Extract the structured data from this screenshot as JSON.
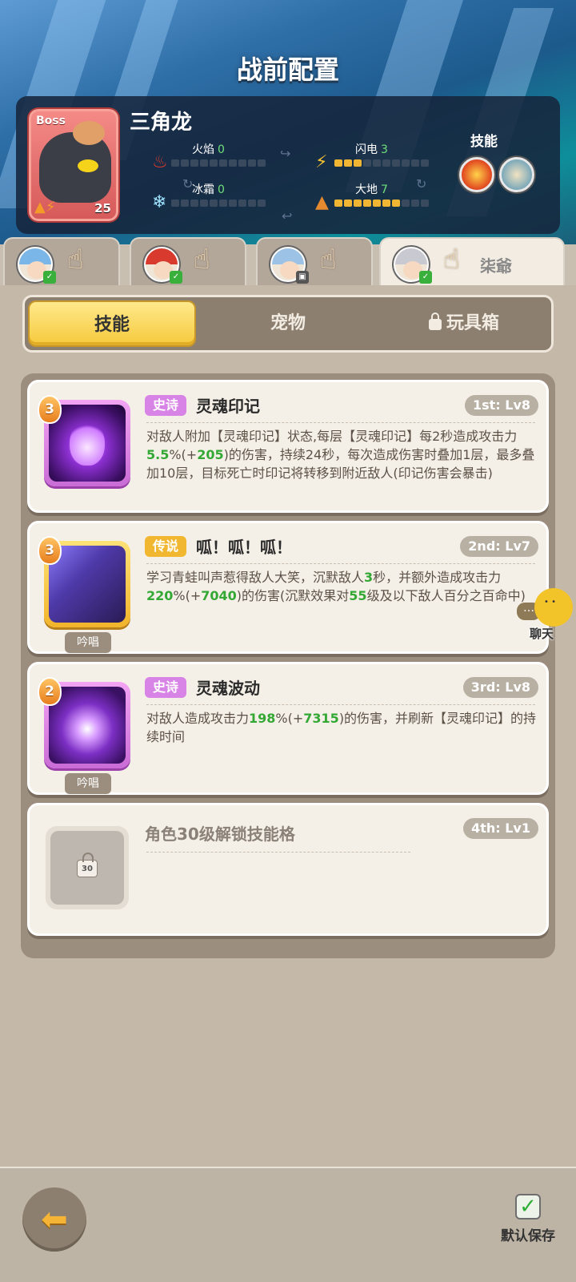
{
  "header": {
    "title": "战前配置"
  },
  "boss": {
    "tag": "Boss",
    "name": "三角龙",
    "level": "25",
    "stats": [
      {
        "label": "火焰",
        "value": "0",
        "icon": "fire-icon",
        "filled": 0,
        "total": 10
      },
      {
        "label": "闪电",
        "value": "3",
        "icon": "lightning-icon",
        "filled": 3,
        "total": 10
      },
      {
        "label": "冰霜",
        "value": "0",
        "icon": "snowflake-icon",
        "filled": 0,
        "total": 10
      },
      {
        "label": "大地",
        "value": "7",
        "icon": "earth-icon",
        "filled": 7,
        "total": 10
      }
    ],
    "skills_label": "技能"
  },
  "characters": [
    {
      "name": "",
      "hair": "#7bb6e8",
      "badge": "green"
    },
    {
      "name": "",
      "hair": "#d93a2e",
      "badge": "green"
    },
    {
      "name": "",
      "hair": "#9cc3e6",
      "badge": "gray"
    },
    {
      "name": "柒爺",
      "hair": "#c9c9d2",
      "badge": "green",
      "active": true
    }
  ],
  "tabs": {
    "skills": "技能",
    "pets": "宠物",
    "toybox": "玩具箱"
  },
  "skill_cards": [
    {
      "level": "3",
      "rarity": "史诗",
      "name": "灵魂印记",
      "slot": "1st: Lv8",
      "desc_parts": [
        {
          "t": "对敌人附加【灵魂印记】状态,每层【灵魂印记】每2秒造成攻击力"
        },
        {
          "t": "5.5",
          "g": true
        },
        {
          "t": "%(+"
        },
        {
          "t": "205",
          "g": true
        },
        {
          "t": ")的伤害，持续24秒，每次造成伤害时叠加1层，最多叠加10层，目标死亡时印记将转移到附近敌人(印记伤害会暴击)"
        }
      ],
      "chant": ""
    },
    {
      "level": "3",
      "rarity": "传说",
      "name": "呱！呱！呱！",
      "slot": "2nd: Lv7",
      "desc_parts": [
        {
          "t": "学习青蛙叫声惹得敌人大笑，沉默敌人"
        },
        {
          "t": "3",
          "g": true
        },
        {
          "t": "秒，并额外造成攻击力"
        },
        {
          "t": "220",
          "g": true
        },
        {
          "t": "%(+"
        },
        {
          "t": "7040",
          "g": true
        },
        {
          "t": ")的伤害(沉默效果对"
        },
        {
          "t": "55",
          "g": true
        },
        {
          "t": "级及以下敌人百分之百命中)"
        }
      ],
      "chant": "吟唱"
    },
    {
      "level": "2",
      "rarity": "史诗",
      "name": "灵魂波动",
      "slot": "3rd: Lv8",
      "desc_parts": [
        {
          "t": "对敌人造成攻击力"
        },
        {
          "t": "198",
          "g": true
        },
        {
          "t": "%(+"
        },
        {
          "t": "7315",
          "g": true
        },
        {
          "t": ")的伤害，并刷新【灵魂印记】的持续时间"
        }
      ],
      "chant": "吟唱"
    }
  ],
  "locked_slot": {
    "text": "角色30级解锁技能格",
    "slot": "4th: Lv1",
    "lock_level": "30"
  },
  "chat": {
    "label": "聊天"
  },
  "footer": {
    "save_label": "默认保存"
  }
}
